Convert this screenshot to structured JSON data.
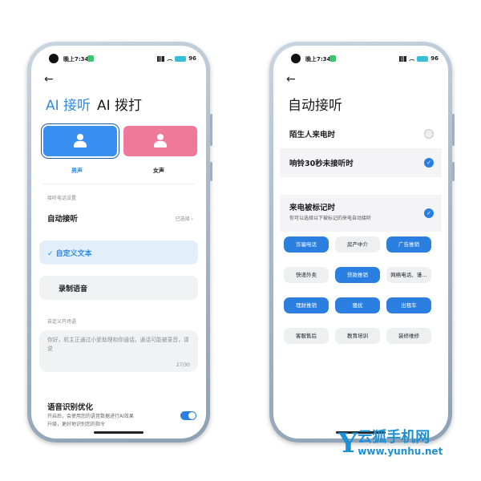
{
  "left_phone": {
    "status": {
      "time": "晚上7:34",
      "battery": "96"
    },
    "tabs": {
      "answer": "AI 接听",
      "dial": "AI 拨打"
    },
    "voices": {
      "male": "男声",
      "female": "女声"
    },
    "section_label": "接听电话设置",
    "auto_answer": {
      "label": "自动接听",
      "value": "已选择 ›"
    },
    "options": {
      "custom_text": "✓ 自定义文本",
      "record_voice": "录制语音"
    },
    "opening_label": "自定义开场语",
    "opening_text": "你好，机主正通过小爱助理和你通话，通话可能被录音，请说",
    "opening_count": "27/30",
    "speech": {
      "title": "语音识别优化",
      "desc_line1": "开启后，会使用您的语音数据进行AI效果",
      "desc_line2": "升级，更好地识别您的指令"
    }
  },
  "right_phone": {
    "status": {
      "time": "晚上7:34",
      "battery": "96"
    },
    "title": "自动接听",
    "rows": {
      "stranger": "陌生人来电时",
      "ring30": "响铃30秒未接听时",
      "marked_title": "来电被标记时",
      "marked_desc": "你可以选择以下被标记的来电自动接听"
    },
    "tags": [
      {
        "label": "诈骗电话",
        "on": true
      },
      {
        "label": "房产中介",
        "on": false
      },
      {
        "label": "广告推销",
        "on": true
      },
      {
        "label": "快递外卖",
        "on": false
      },
      {
        "label": "贷款推销",
        "on": true
      },
      {
        "label": "网络电话、谨…",
        "on": false
      },
      {
        "label": "理财推销",
        "on": true
      },
      {
        "label": "骚扰",
        "on": true
      },
      {
        "label": "出租车",
        "on": true
      },
      {
        "label": "客服售后",
        "on": false
      },
      {
        "label": "教育培训",
        "on": false
      },
      {
        "label": "装修维修",
        "on": false
      }
    ]
  },
  "watermark": {
    "letter": "Y",
    "name": "云狐手机网",
    "url": "www.yunhu.net"
  },
  "colors": {
    "accent": "#2a8be8",
    "male_card": "#3a8ef0",
    "female_card": "#f0789b"
  }
}
